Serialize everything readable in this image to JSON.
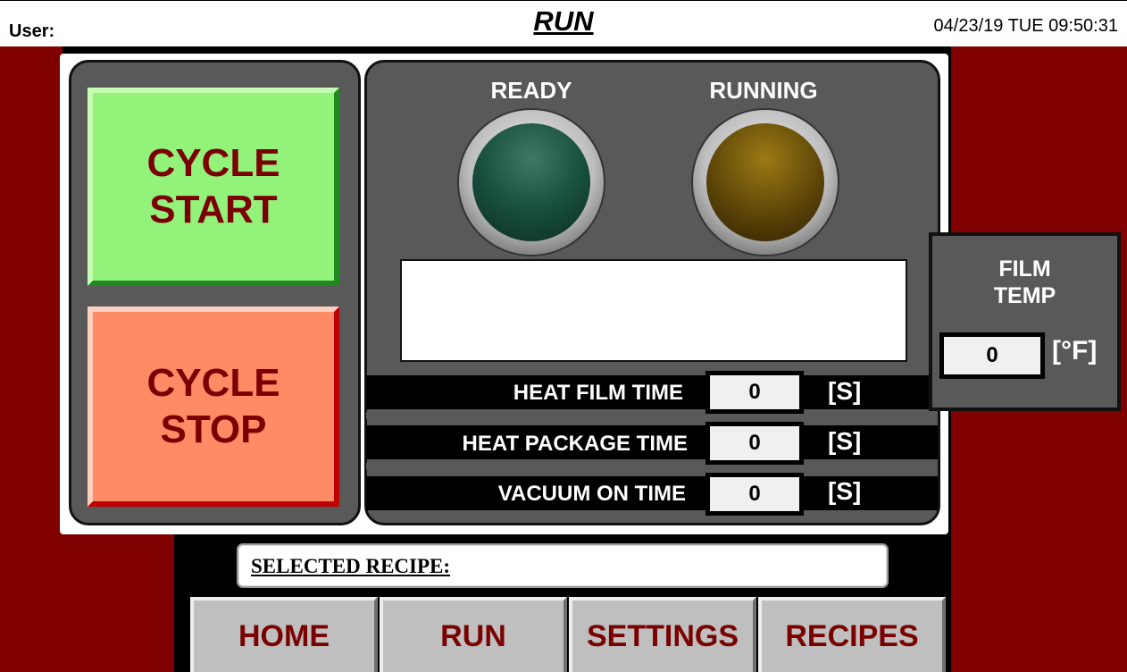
{
  "header": {
    "user_label": "User:",
    "title": "RUN",
    "datetime": "04/23/19 TUE  09:50:31"
  },
  "controls": {
    "cycle_start": [
      "CYCLE",
      "START"
    ],
    "cycle_stop": [
      "CYCLE",
      "STOP"
    ]
  },
  "indicators": {
    "ready": {
      "label": "READY",
      "state": "off",
      "color": "#18503f"
    },
    "running": {
      "label": "RUNNING",
      "state": "off",
      "color": "#5f4608"
    }
  },
  "message": "",
  "timers": [
    {
      "label": "HEAT FILM TIME",
      "value": "0",
      "unit": "[S]"
    },
    {
      "label": "HEAT PACKAGE TIME",
      "value": "0",
      "unit": "[S]"
    },
    {
      "label": "VACUUM ON TIME",
      "value": "0",
      "unit": "[S]"
    }
  ],
  "film_temp": {
    "label_line1": "FILM",
    "label_line2": "TEMP",
    "value": "0",
    "unit": "[°F]"
  },
  "recipe": {
    "label": "SELECTED RECIPE:",
    "value": ""
  },
  "nav": [
    {
      "label": "HOME"
    },
    {
      "label": "RUN"
    },
    {
      "label": "SETTINGS"
    },
    {
      "label": "RECIPES"
    }
  ],
  "colors": {
    "background_red": "#800000",
    "panel_gray": "#595959",
    "start_green": "#93f27a",
    "stop_salmon": "#ff8a66",
    "button_text": "#7a0000"
  }
}
